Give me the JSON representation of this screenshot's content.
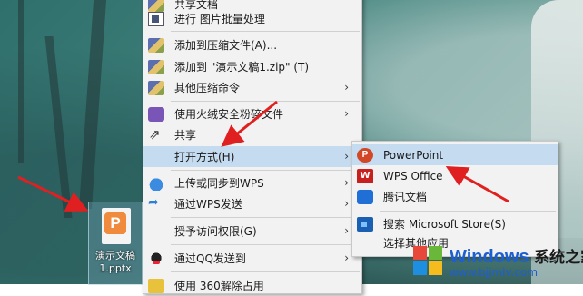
{
  "main_menu": {
    "items": [
      {
        "label": "共享文档",
        "icon": "folder-share-icon",
        "arrow": false
      },
      {
        "label": "进行 图片批量处理",
        "icon": "batch-image-icon",
        "arrow": false
      },
      {
        "label": "添加到压缩文件(A)...",
        "icon": "winrar-icon",
        "arrow": false
      },
      {
        "label": "添加到 \"演示文稿1.zip\" (T)",
        "icon": "winrar-icon",
        "arrow": false
      },
      {
        "label": "其他压缩命令",
        "icon": "winrar-icon",
        "arrow": true
      },
      {
        "label": "使用火绒安全粉碎文件",
        "icon": "shredder-icon",
        "arrow": true
      },
      {
        "label": "共享",
        "icon": "share-icon",
        "arrow": false
      },
      {
        "label": "打开方式(H)",
        "icon": "",
        "arrow": true
      },
      {
        "label": "上传或同步到WPS",
        "icon": "cloud-icon",
        "arrow": true
      },
      {
        "label": "通过WPS发送",
        "icon": "send-icon",
        "arrow": true
      },
      {
        "label": "授予访问权限(G)",
        "icon": "",
        "arrow": true
      },
      {
        "label": "通过QQ发送到",
        "icon": "qq-icon",
        "arrow": true
      },
      {
        "label": "使用 360解除占用",
        "icon": "360-icon",
        "arrow": false
      }
    ]
  },
  "open_with_menu": {
    "items": [
      {
        "label": "PowerPoint",
        "icon": "powerpoint-icon"
      },
      {
        "label": "WPS Office",
        "icon": "wps-office-icon"
      },
      {
        "label": "腾讯文档",
        "icon": "tencent-docs-icon"
      },
      {
        "label": "搜索 Microsoft Store(S)",
        "icon": "microsoft-store-icon"
      },
      {
        "label": "选择其他应用",
        "icon": ""
      }
    ]
  },
  "desktop_file": {
    "name_line1": "演示文稿",
    "name_line2": "1.pptx"
  },
  "watermark": {
    "brand": "Windows",
    "suffix": "系统之家",
    "url": "www.bjjmlv.com"
  },
  "colors": {
    "highlight": "#c5dbf0",
    "arrow_red": "#e02020",
    "menu_bg": "#f2f2f2"
  }
}
